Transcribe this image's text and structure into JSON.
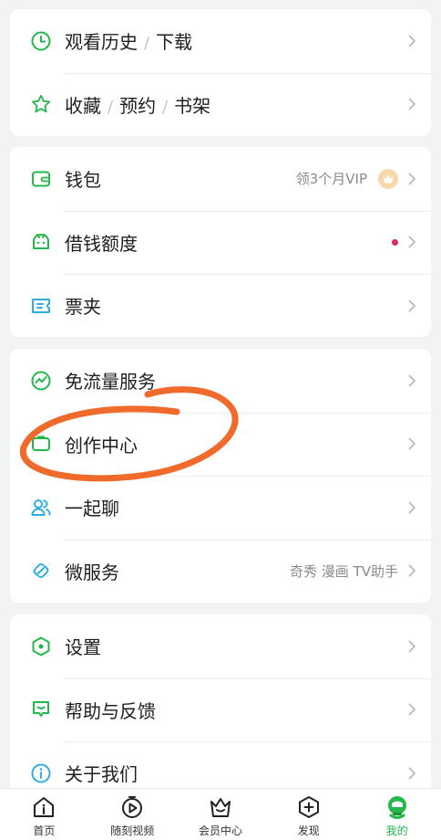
{
  "group1": {
    "history_label": "观看历史",
    "download_label": "下载",
    "favorite_label": "收藏",
    "reserve_label": "预约",
    "bookshelf_label": "书架",
    "separator": "/"
  },
  "group2": {
    "wallet_label": "钱包",
    "wallet_promo": "领3个月VIP",
    "loan_label": "借钱额度",
    "tickets_label": "票夹"
  },
  "group3": {
    "data_free_label": "免流量服务",
    "creator_label": "创作中心",
    "chat_label": "一起聊",
    "micro_label": "微服务",
    "micro_right": "奇秀 漫画 TV助手"
  },
  "group4": {
    "settings_label": "设置",
    "help_label": "帮助与反馈",
    "about_label": "关于我们"
  },
  "bottom_nav": {
    "home": "首页",
    "moment": "随刻视频",
    "vip": "会员中心",
    "discover": "发现",
    "mine": "我的"
  },
  "colors": {
    "accent_green": "#22b84a",
    "icon_blue": "#2eaee4",
    "annotation_orange": "#f06a2c",
    "dot_red": "#e0245e"
  },
  "icons": {
    "history": "clock-icon",
    "favorite": "star-icon",
    "wallet": "wallet-icon",
    "loan": "loan-icon",
    "tickets": "ticket-icon",
    "data_free": "wave-icon",
    "creator": "creator-icon",
    "chat": "people-icon",
    "micro": "link-icon",
    "settings": "hexagon-icon",
    "help": "chat-bubble-icon",
    "about": "info-icon"
  },
  "active_tab": "mine"
}
